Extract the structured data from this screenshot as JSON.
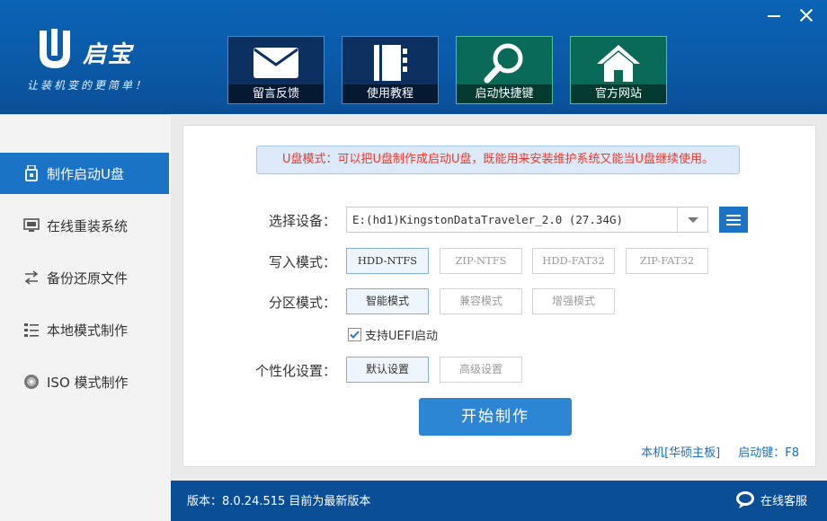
{
  "app": {
    "brand_name": "启宝",
    "slogan": "让装机变的更简单！"
  },
  "top_nav": [
    {
      "label": "留言反馈",
      "icon": "envelope-icon"
    },
    {
      "label": "使用教程",
      "icon": "notebook-icon"
    },
    {
      "label": "启动快捷键",
      "icon": "magnifier-icon"
    },
    {
      "label": "官方网站",
      "icon": "home-icon"
    }
  ],
  "sidebar": {
    "items": [
      {
        "label": "制作启动U盘",
        "icon": "usb-drive-icon",
        "active": true
      },
      {
        "label": "在线重装系统",
        "icon": "monitor-icon",
        "active": false
      },
      {
        "label": "备份还原文件",
        "icon": "backup-icon",
        "active": false
      },
      {
        "label": "本地模式制作",
        "icon": "list-icon",
        "active": false
      },
      {
        "label": "ISO 模式制作",
        "icon": "disc-icon",
        "active": false
      }
    ]
  },
  "main": {
    "notice": "U盘模式：可以把U盘制作成启动U盘，既能用来安装维护系统又能当U盘继续使用。",
    "device": {
      "label": "选择设备：",
      "value": "E:(hd1)KingstonDataTraveler_2.0 (27.34G)"
    },
    "write_mode": {
      "label": "写入模式：",
      "options": [
        "HDD-NTFS",
        "ZIP-NTFS",
        "HDD-FAT32",
        "ZIP-FAT32"
      ],
      "selected": "HDD-NTFS"
    },
    "partition_mode": {
      "label": "分区模式：",
      "options": [
        "智能模式",
        "兼容模式",
        "增强模式"
      ],
      "selected": "智能模式"
    },
    "uefi": {
      "label": "支持UEFI启动",
      "checked": true
    },
    "personalize": {
      "label": "个性化设置：",
      "options": [
        "默认设置",
        "高级设置"
      ],
      "selected": "默认设置"
    },
    "start_button": "开始制作",
    "machine": "本机[华硕主板]",
    "boot_key": "启动键：F8"
  },
  "footer": {
    "version": "版本：8.0.24.515 目前为最新版本",
    "service": "在线客服"
  },
  "colors": {
    "header_blue": "#0a5aa8",
    "accent_blue": "#1a73c4",
    "notice_red": "#e83a2b",
    "tile_green": "#0a6a58"
  }
}
